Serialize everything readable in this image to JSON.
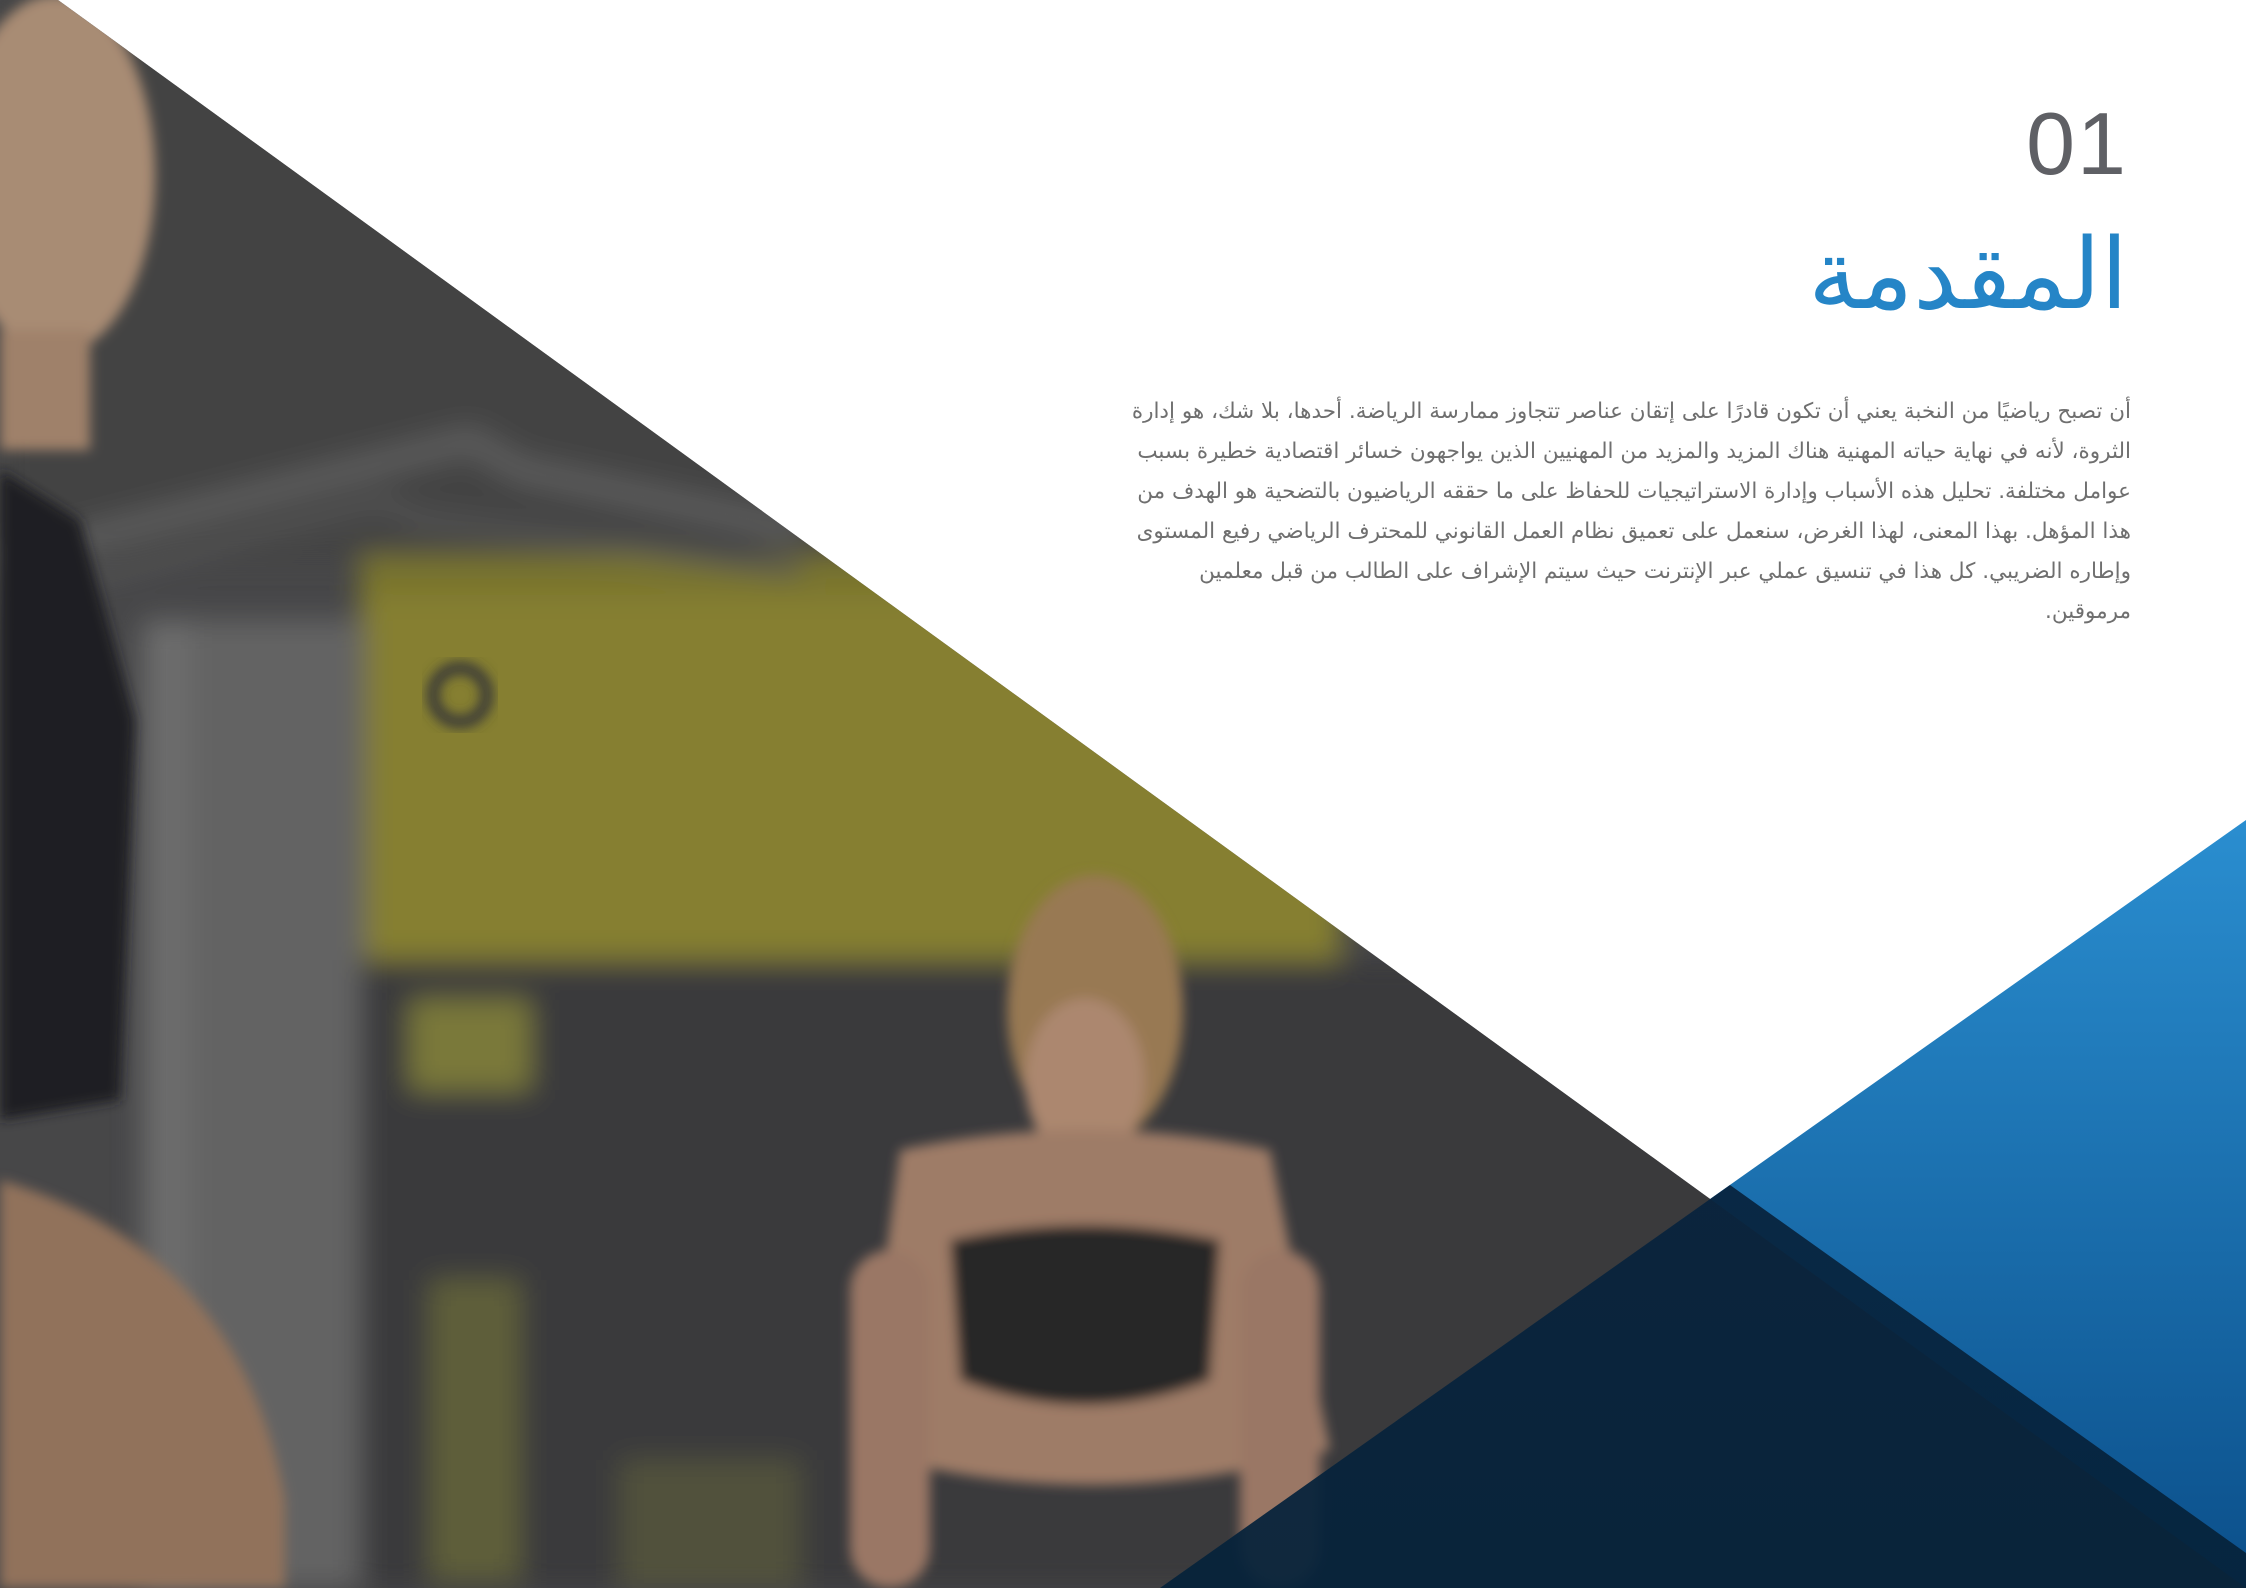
{
  "section": {
    "number": "01",
    "title": "المقدمة",
    "body": "أن تصبح رياضيًا من النخبة يعني أن تكون قادرًا على إتقان عناصر تتجاوز ممارسة الرياضة. أحدها، بلا شك، هو إدارة الثروة، لأنه في نهاية حياته المهنية هناك المزيد والمزيد من المهنيين الذين يواجهون خسائر اقتصادية خطيرة بسبب عوامل مختلفة.  تحليل هذه الأسباب وإدارة الاستراتيجيات للحفاظ على ما حققه الرياضيون بالتضحية هو الهدف من هذا المؤهل. بهذا المعنى، لهذا الغرض، سنعمل على تعميق نظام العمل القانوني للمحترف الرياضي رفيع المستوى وإطاره الضريبي. كل هذا في تنسيق عملي عبر الإنترنت حيث سيتم الإشراف على الطالب من قبل معلمين مرموقين."
  },
  "colors": {
    "accent_blue": "#2585c7",
    "dark_blue": "#0a3a68",
    "number_gray": "#5f6065",
    "body_gray": "#6f6f6f"
  }
}
